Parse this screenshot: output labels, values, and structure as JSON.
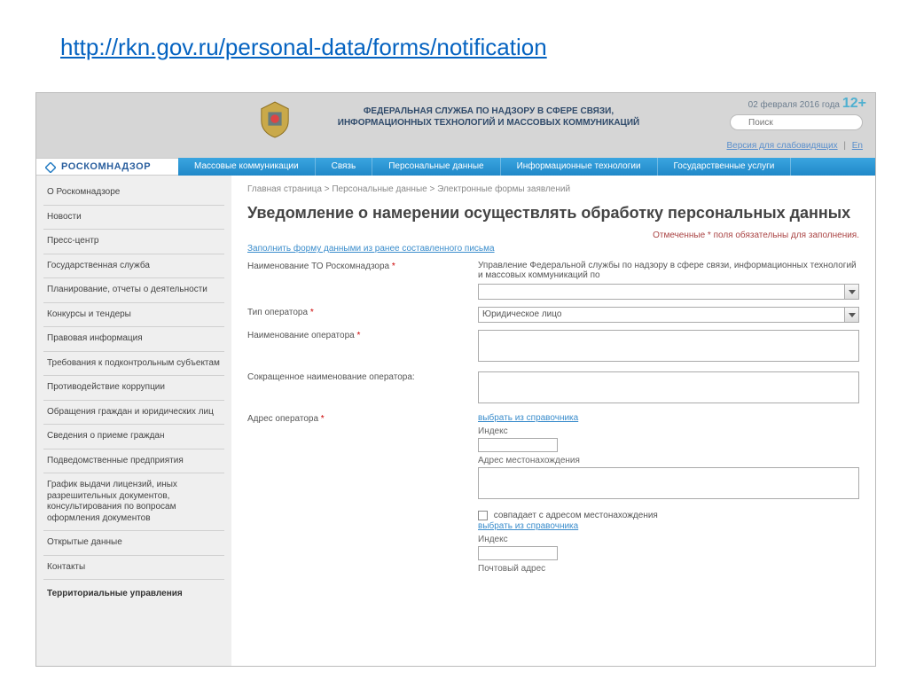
{
  "slide_url": "http://rkn.gov.ru/personal-data/forms/notification",
  "header": {
    "date": "02 февраля 2016 года",
    "age_rating": "12+",
    "search_placeholder": "Поиск",
    "title_line1": "ФЕДЕРАЛЬНАЯ СЛУЖБА ПО НАДЗОРУ В СФЕРЕ СВЯЗИ,",
    "title_line2": "ИНФОРМАЦИОННЫХ ТЕХНОЛОГИЙ И МАССОВЫХ КОММУНИКАЦИЙ",
    "accessibility_link": "Версия для слабовидящих",
    "lang_link": "En",
    "logo_text": "РОСКОМНАДЗОР"
  },
  "nav": [
    "Массовые коммуникации",
    "Связь",
    "Персональные данные",
    "Информационные технологии",
    "Государственные услуги"
  ],
  "sidebar": {
    "items": [
      "О Роскомнадзоре",
      "Новости",
      "Пресс-центр",
      "Государственная служба",
      "Планирование, отчеты о деятельности",
      "Конкурсы и тендеры",
      "Правовая информация",
      "Требования к подконтрольным субъектам",
      "Противодействие коррупции",
      "Обращения граждан и юридических лиц",
      "Сведения о приеме граждан",
      "Подведомственные предприятия",
      "График выдачи лицензий, иных разрешительных документов, консультирования по вопросам оформления документов",
      "Открытые данные",
      "Контакты"
    ],
    "section_header": "Территориальные управления"
  },
  "breadcrumb": "Главная страница > Персональные данные > Электронные формы заявлений",
  "page_title": "Уведомление о намерении осуществлять обработку персональных данных",
  "required_note": "Отмеченные * поля обязательны для заполнения.",
  "prefill_link": "Заполнить форму данными из ранее составленного письма",
  "form": {
    "org_label": "Наименование ТО Роскомнадзора",
    "org_value": "Управление Федеральной службы по надзору в сфере связи, информационных технологий и массовых коммуникаций по",
    "type_label": "Тип оператора",
    "type_value": "Юридическое лицо",
    "name_label": "Наименование оператора",
    "short_name_label": "Сокращенное наименование оператора:",
    "addr_label": "Адрес оператора",
    "addr_link": "выбрать из справочника",
    "index_label": "Индекс",
    "loc_addr_label": "Адрес местонахождения",
    "same_addr_label": "совпадает с адресом местонахождения",
    "addr_link2": "выбрать из справочника",
    "index_label2": "Индекс",
    "post_addr_label": "Почтовый адрес"
  }
}
